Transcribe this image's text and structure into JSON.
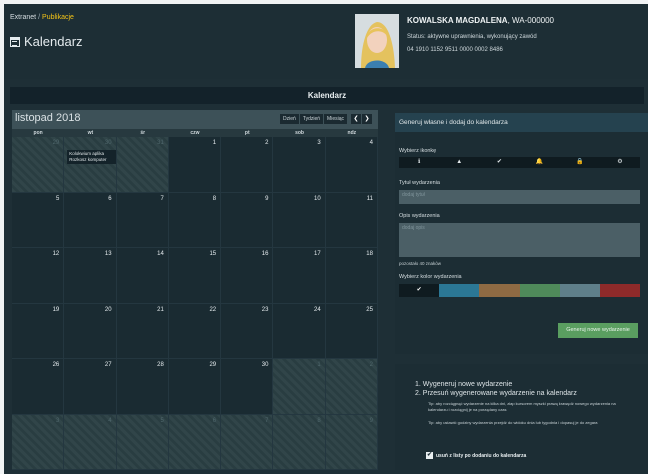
{
  "breadcrumb": {
    "home": "Extranet",
    "separator": "/",
    "current": "Publikacje"
  },
  "page": {
    "title": "Kalendarz"
  },
  "user": {
    "name": "KOWALSKA MAGDALENA",
    "id_suffix": ", WA-000000",
    "status": "Status: aktywne uprawnienia, wykonujący zawód",
    "account": "04 1910 1152 9511 0000 0002 8486"
  },
  "section_header": "Kalendarz",
  "calendar": {
    "month": "listopad 2018",
    "views": [
      "Dzień",
      "Tydzień",
      "Miesiąc"
    ],
    "nav": {
      "prev": "❮",
      "next": "❯"
    },
    "weekdays": [
      "pon",
      "wt",
      "śr",
      "czw",
      "pt",
      "sob",
      "ndz"
    ],
    "weeks": [
      [
        "29",
        "30",
        "31",
        "1",
        "2",
        "3",
        "4"
      ],
      [
        "5",
        "6",
        "7",
        "8",
        "9",
        "10",
        "11"
      ],
      [
        "12",
        "13",
        "14",
        "15",
        "16",
        "17",
        "18"
      ],
      [
        "19",
        "20",
        "21",
        "22",
        "23",
        "24",
        "25"
      ],
      [
        "26",
        "27",
        "28",
        "29",
        "30",
        "1",
        "2"
      ],
      [
        "3",
        "4",
        "5",
        "6",
        "7",
        "8",
        "9"
      ]
    ],
    "event": {
      "line1": "Kolokwium aplika",
      "line2": "Rozkosz komputer"
    }
  },
  "generator": {
    "header": "Generuj własne i dodaj do kalendarza",
    "icon_label": "Wybierz ikonkę",
    "icons": [
      {
        "name": "info-icon",
        "glyph": "ℹ"
      },
      {
        "name": "warning-icon",
        "glyph": "▲"
      },
      {
        "name": "check-icon",
        "glyph": "✔"
      },
      {
        "name": "bell-icon",
        "glyph": "🔔"
      },
      {
        "name": "lock-icon",
        "glyph": "🔒"
      },
      {
        "name": "gear-icon",
        "glyph": "⚙"
      }
    ],
    "title_label": "Tytuł wydarzenia",
    "title_placeholder": "dodaj tytuł",
    "desc_label": "Opis wydarzenia",
    "desc_placeholder": "dodaj opis",
    "remaining": "pozostało 40 znaków",
    "color_label": "Wybierz kolor wydarzenia",
    "colors": [
      "#0f1b20",
      "#2b7795",
      "#8e6a43",
      "#4f8a5a",
      "#5f7f8a",
      "#8e2a2a"
    ],
    "selected_mark": "✔",
    "button": "Generuj nowe wydarzenie"
  },
  "instructions": {
    "step1": "1. Wygeneruj nowe wydarzenie",
    "step2": "2. Przesuń wygenerowane wydarzenie na kalendarz",
    "tip1": "Tip: aby rozciągnąć wydarzenie na kilka dni, złap kursorem myszki prawą krawędź nowego wydarzenia na kalendarzu i rozciągnij je na porządany czas",
    "tip2": "Tip: aby ustawić godziny wydarzenia przejdź do widoku dnia lub tygodnia i dopasuj je do zegara",
    "checkbox_mark": "✔",
    "checkbox_label": "usuń z listy po dodaniu do kalendarza"
  }
}
